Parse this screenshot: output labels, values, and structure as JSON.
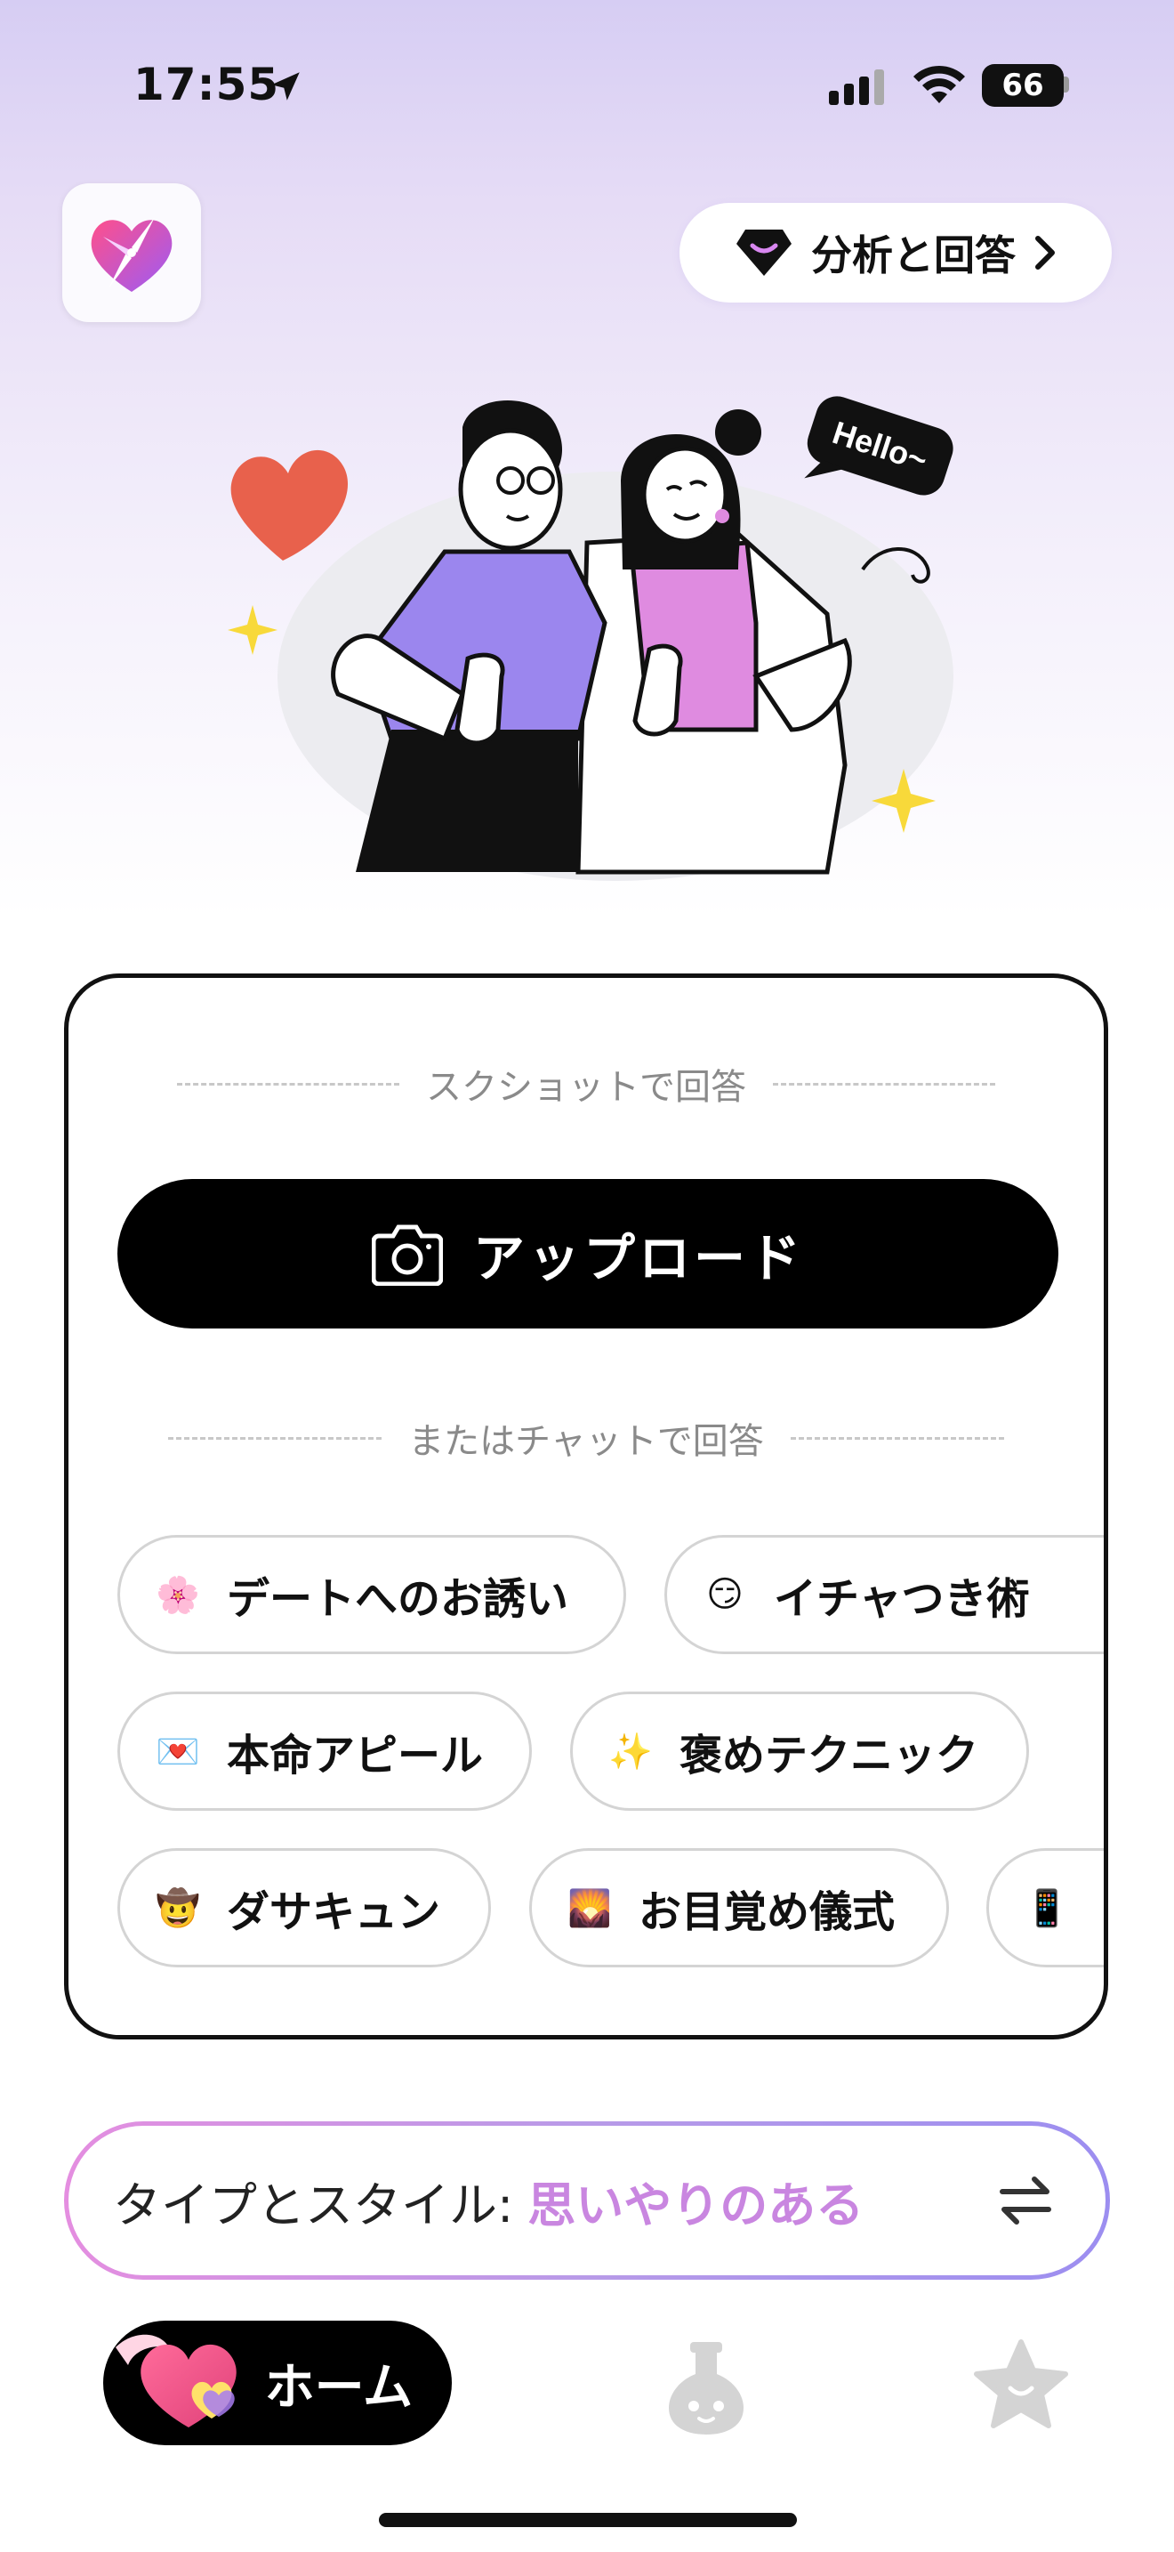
{
  "status_bar": {
    "time": "17:55",
    "battery": "66"
  },
  "header": {
    "analyze_label": "分析と回答"
  },
  "card": {
    "screenshot_divider": "スクショットで回答",
    "upload_label": "アップロード",
    "chat_divider": "またはチャットで回答",
    "chips": [
      {
        "emoji": "🌸",
        "label": "デートへのお誘い"
      },
      {
        "emoji": "😏",
        "label": "イチャつき術"
      },
      {
        "emoji": "💌",
        "label": "本命アピール"
      },
      {
        "emoji": "✨",
        "label": "褒めテクニック"
      },
      {
        "emoji": "🤠",
        "label": "ダサキュン"
      },
      {
        "emoji": "🌄",
        "label": "お目覚め儀式"
      },
      {
        "emoji": "📱",
        "label": ""
      }
    ]
  },
  "hero": {
    "speech_bubble": "Hello~"
  },
  "type_style": {
    "label": "タイプとスタイル:",
    "value": "思いやりのある"
  },
  "tab_bar": {
    "home_label": "ホーム"
  },
  "colors": {
    "accent": "#c986e0",
    "primary": "#000000",
    "background_top": "#d6cdf3"
  }
}
